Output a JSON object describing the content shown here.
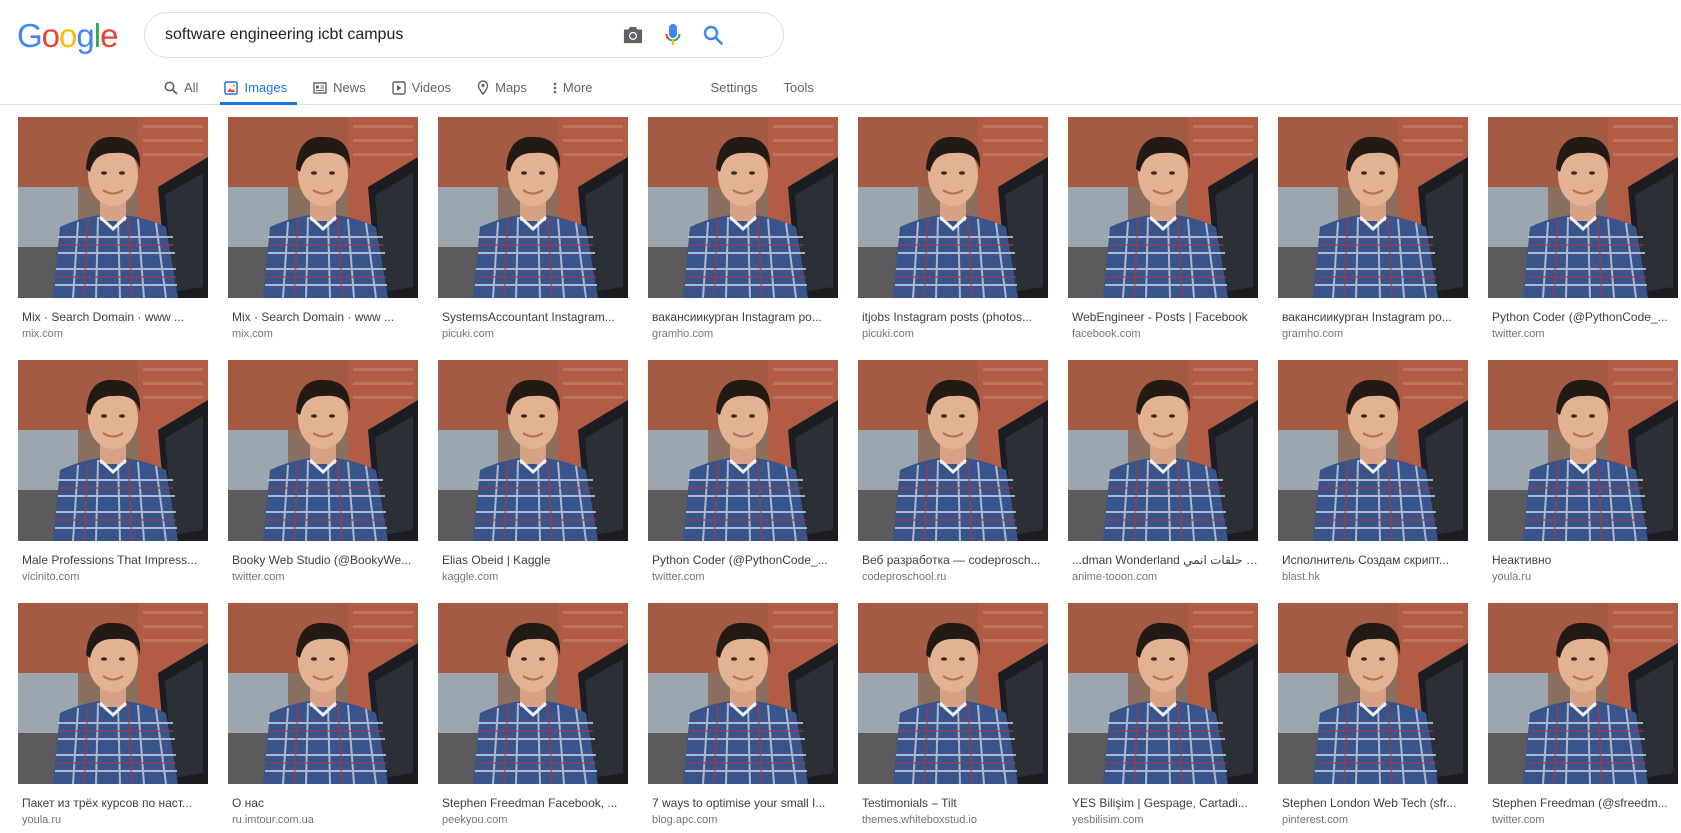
{
  "logo": {
    "letters": [
      "G",
      "o",
      "o",
      "g",
      "l",
      "e"
    ],
    "colors": [
      "#4285f4",
      "#ea4335",
      "#fbbc05",
      "#4285f4",
      "#34a853",
      "#ea4335"
    ]
  },
  "search": {
    "value": "software engineering icbt campus",
    "camera_icon": "camera-icon",
    "mic_icon": "microphone-icon",
    "search_icon": "search-icon"
  },
  "tabs": {
    "all": "All",
    "images": "Images",
    "news": "News",
    "videos": "Videos",
    "maps": "Maps",
    "more": "More",
    "settings": "Settings",
    "tools": "Tools"
  },
  "accent_color": "#1a73e8",
  "results": [
    {
      "title": "Mix · Search Domain · www ...",
      "source": "mix.com"
    },
    {
      "title": "Mix · Search Domain · www ...",
      "source": "mix.com"
    },
    {
      "title": "SystemsAccountant Instagram...",
      "source": "picuki.com"
    },
    {
      "title": "вакансиикурган Instagram po...",
      "source": "gramho.com"
    },
    {
      "title": "itjobs Instagram posts (photos...",
      "source": "picuki.com"
    },
    {
      "title": "WebEngineer - Posts | Facebook",
      "source": "facebook.com"
    },
    {
      "title": "вакансиикурган Instagram po...",
      "source": "gramho.com"
    },
    {
      "title": "Python Coder (@PythonCode_...",
      "source": "twitter.com"
    },
    {
      "title": "Male Professions That Impress...",
      "source": "vicinito.com"
    },
    {
      "title": "Booky Web Studio (@BookyWe...",
      "source": "twitter.com"
    },
    {
      "title": "Elias Obeid | Kaggle",
      "source": "kaggle.com"
    },
    {
      "title": "Python Coder (@PythonCode_...",
      "source": "twitter.com"
    },
    {
      "title": "Веб разработка — codeprosch...",
      "source": "codeproschool.ru"
    },
    {
      "title": "...dman Wonderland جميع حلقات انمي",
      "source": "anime-tooon.com"
    },
    {
      "title": "Исполнитель Создам скрипт...",
      "source": "blast.hk"
    },
    {
      "title": "Неактивно",
      "source": "youla.ru"
    },
    {
      "title": "Пакет из трёх курсов по наст...",
      "source": "youla.ru"
    },
    {
      "title": "О нас",
      "source": "ru.imtour.com.ua"
    },
    {
      "title": "Stephen Freedman Facebook, ...",
      "source": "peekyou.com"
    },
    {
      "title": "7 ways to optimise your small I...",
      "source": "blog.apc.com"
    },
    {
      "title": "Testimonials – Tilt",
      "source": "themes.whiteboxstud.io"
    },
    {
      "title": "YES Bilişim | Gespage, Cartadi...",
      "source": "yesbilisim.com"
    },
    {
      "title": "Stephen London Web Tech (sfr...",
      "source": "pinterest.com"
    },
    {
      "title": "Stephen Freedman (@sfreedm...",
      "source": "twitter.com"
    }
  ]
}
